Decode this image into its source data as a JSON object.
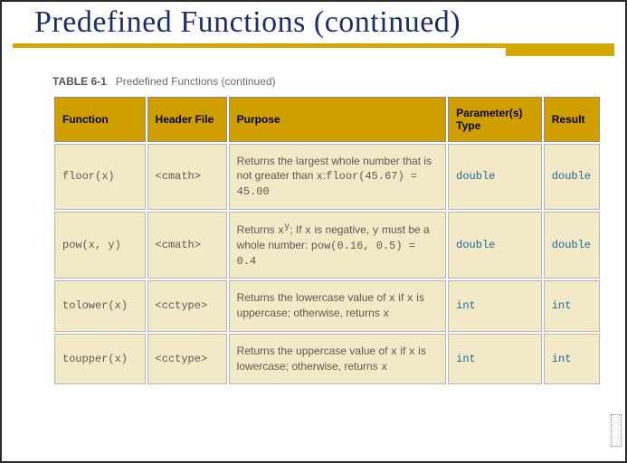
{
  "title": "Predefined Functions (continued)",
  "table": {
    "caption_strong": "TABLE 6-1",
    "caption_rest": "Predefined Functions (continued)",
    "headers": {
      "c1": "Function",
      "c2": "Header File",
      "c3": "Purpose",
      "c4": "Parameter(s) Type",
      "c5": "Result"
    },
    "rows": [
      {
        "func": "floor(x)",
        "header": "<cmath>",
        "purpose_html": "Returns the largest whole number that is not greater than <span class=\"mono-inline\">x</span>:<span class=\"mono-inline\">floor(45.67) = 45.00</span>",
        "param": "double",
        "result": "double"
      },
      {
        "func": "pow(x, y)",
        "header": "<cmath>",
        "purpose_html": "Returns <span class=\"mono-inline\">x<sup>y</sup></span>; If <span class=\"mono-inline\">x</span> is negative, <span class=\"mono-inline\">y</span> must be a whole number: <span class=\"mono-inline\">pow(0.16, 0.5) = 0.4</span>",
        "param": "double",
        "result": "double"
      },
      {
        "func": "tolower(x)",
        "header": "<cctype>",
        "purpose_html": "Returns the lowercase value of <span class=\"mono-inline\">x</span> if <span class=\"mono-inline\">x</span> is uppercase; otherwise, returns <span class=\"mono-inline\">x</span>",
        "param": "int",
        "result": "int"
      },
      {
        "func": "toupper(x)",
        "header": "<cctype>",
        "purpose_html": "Returns the uppercase value of <span class=\"mono-inline\">x</span> if <span class=\"mono-inline\">x</span> is lowercase; otherwise, returns <span class=\"mono-inline\">x</span>",
        "param": "int",
        "result": "int"
      }
    ]
  }
}
